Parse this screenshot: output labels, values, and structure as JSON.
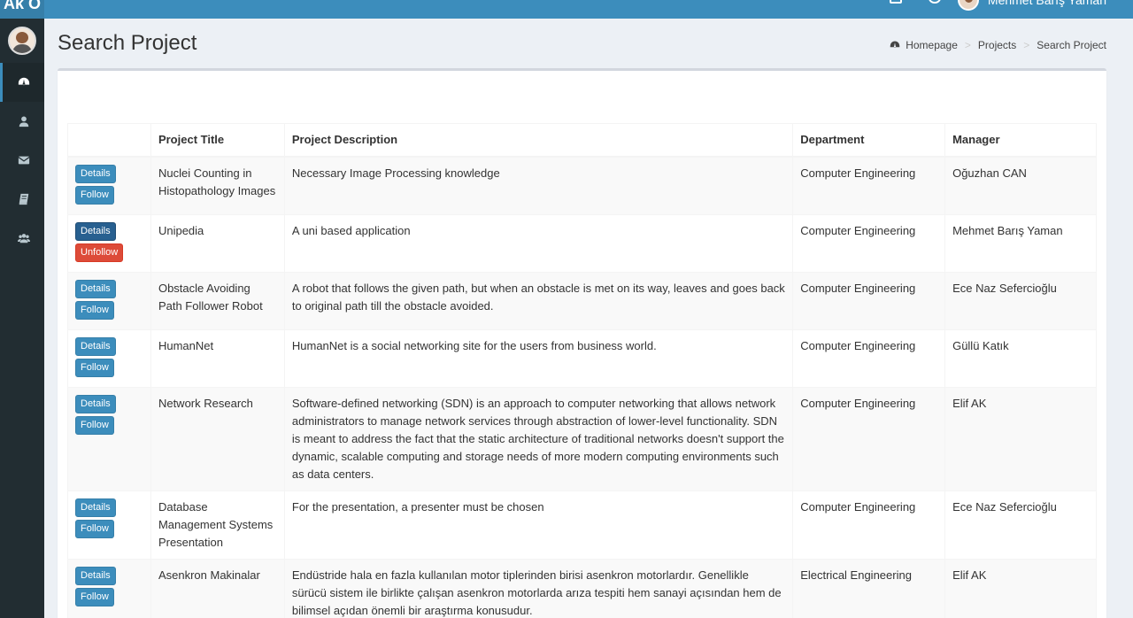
{
  "topbar": {
    "logo_text": "Ak O",
    "user_name": "Mehmet Barış Yaman"
  },
  "sidebar": {
    "items": [
      {
        "icon": "dashboard-icon"
      },
      {
        "icon": "user-icon"
      },
      {
        "icon": "envelope-icon"
      },
      {
        "icon": "book-icon"
      },
      {
        "icon": "users-icon"
      }
    ]
  },
  "header": {
    "title": "Search Project",
    "breadcrumb": [
      "Homepage",
      "Projects",
      "Search Project"
    ]
  },
  "table": {
    "headers": [
      "",
      "Project Title",
      "Project Description",
      "Department",
      "Manager"
    ],
    "rows": [
      {
        "title": "Nuclei Counting in Histopathology Images",
        "description": "Necessary Image Processing knowledge",
        "department": "Computer Engineering",
        "manager": "Oğuzhan CAN",
        "details": "Details",
        "follow": "Follow"
      },
      {
        "title": "Unipedia",
        "description": "A uni based application",
        "department": "Computer Engineering",
        "manager": "Mehmet Barış Yaman",
        "details": "Details",
        "follow": "Unfollow"
      },
      {
        "title": "Obstacle Avoiding Path Follower Robot",
        "description": "A robot that follows the given path, but when an obstacle is met on its way, leaves and goes back to original path till the obstacle avoided.",
        "department": "Computer Engineering",
        "manager": "Ece Naz Sefercioğlu",
        "details": "Details",
        "follow": "Follow"
      },
      {
        "title": "HumanNet",
        "description": "HumanNet is a social networking site for the users from business world.",
        "department": "Computer Engineering",
        "manager": "Güllü Katık",
        "details": "Details",
        "follow": "Follow"
      },
      {
        "title": "Network Research",
        "description": "Software-defined networking (SDN) is an approach to computer networking that allows network administrators to manage network services through abstraction of lower-level functionality. SDN is meant to address the fact that the static architecture of traditional networks doesn't support the dynamic, scalable computing and storage needs of more modern computing environments such as data centers.",
        "department": "Computer Engineering",
        "manager": "Elif AK",
        "details": "Details",
        "follow": "Follow"
      },
      {
        "title": "Database Management Systems Presentation",
        "description": "For the presentation, a presenter must be chosen",
        "department": "Computer Engineering",
        "manager": "Ece Naz Sefercioğlu",
        "details": "Details",
        "follow": "Follow"
      },
      {
        "title": "Asenkron Makinalar",
        "description": "Endüstride hala en fazla kullanılan motor tiplerinden birisi asenkron motorlardır. Genellikle sürücü sistem ile birlikte çalışan asenkron motorlarda arıza tespiti hem sanayi açısından hem de bilimsel açıdan önemli bir araştırma konusudur.",
        "department": "Electrical Engineering",
        "manager": "Elif AK",
        "details": "Details",
        "follow": "Follow"
      }
    ]
  },
  "colors": {
    "topbar": "#3c8dbc",
    "sidebar": "#222d32",
    "button_primary": "#3c8dbc",
    "button_danger": "#dd4b39"
  }
}
